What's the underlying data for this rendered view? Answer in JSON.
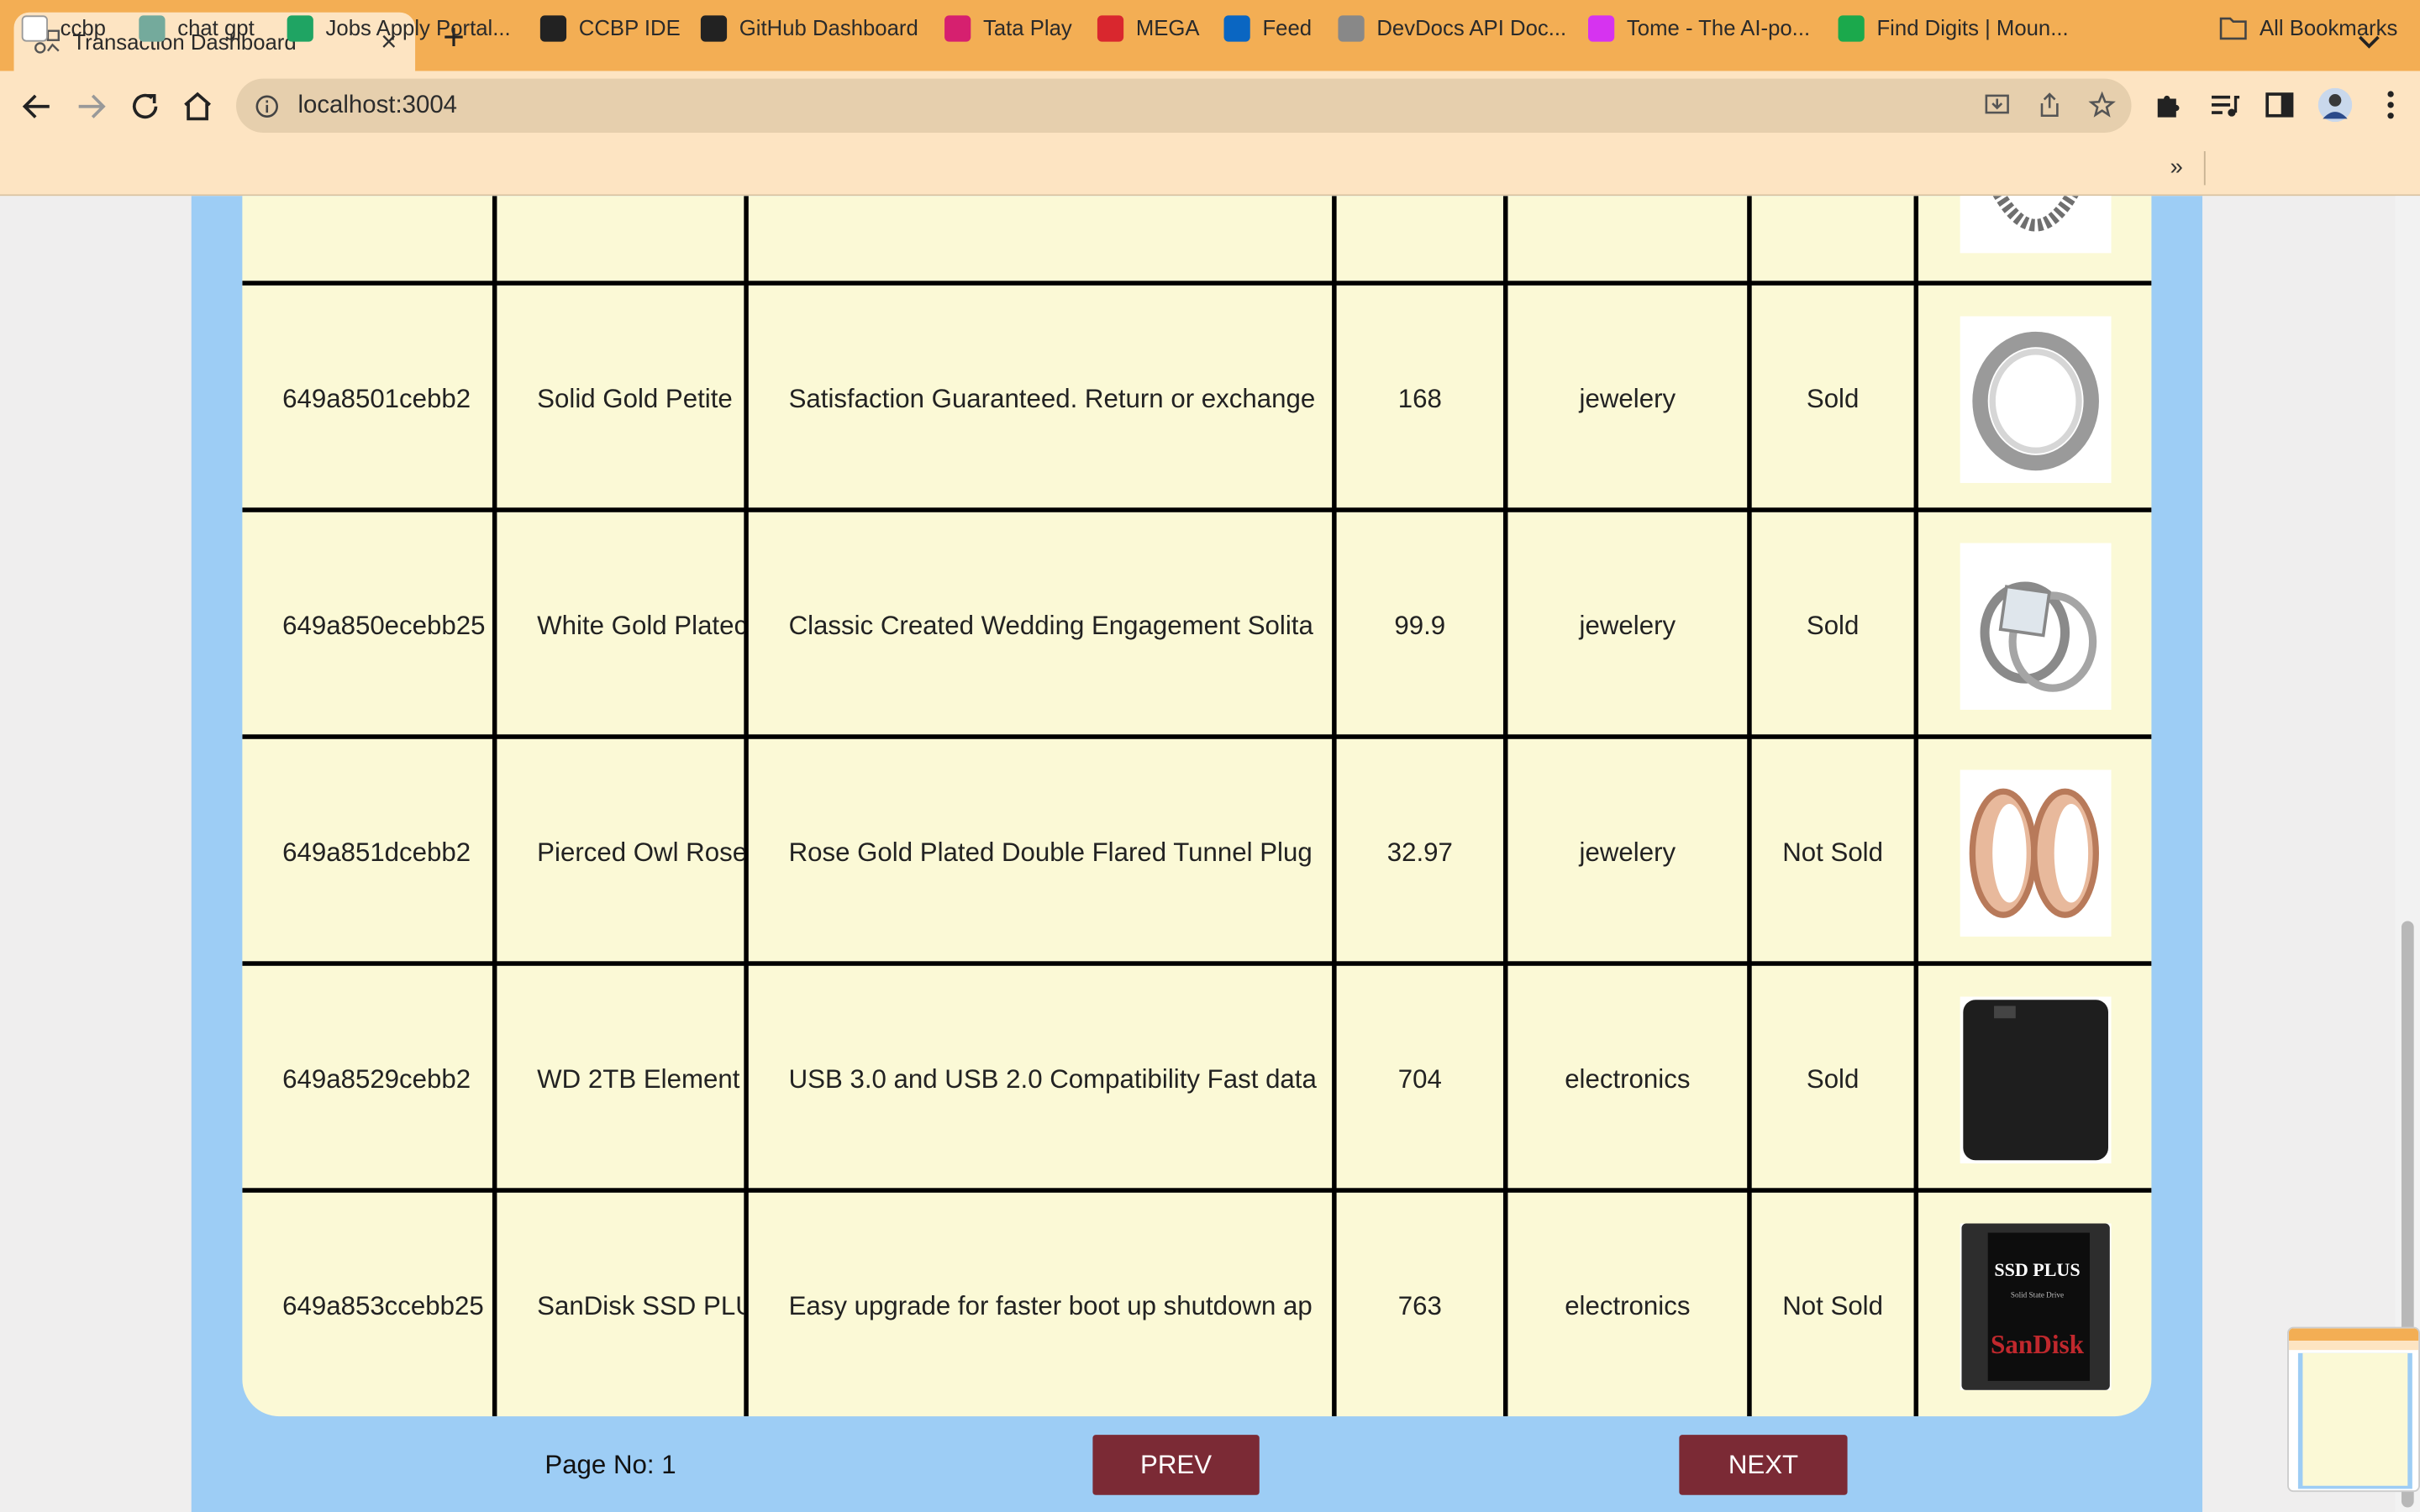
{
  "browser": {
    "tab_title": "Transaction Dashboard",
    "url": "localhost:3004",
    "bookmarks": [
      {
        "label": "ccbp",
        "icon": "ccbp-icon",
        "color": "#ffffff"
      },
      {
        "label": "chat gpt",
        "icon": "chatgpt-icon",
        "color": "#74aa9c"
      },
      {
        "label": "Jobs Apply Portal...",
        "icon": "plus-sheet-icon",
        "color": "#1fa463"
      },
      {
        "label": "CCBP IDE",
        "icon": "circle-arrow-icon",
        "color": "#222222"
      },
      {
        "label": "GitHub Dashboard",
        "icon": "github-icon",
        "color": "#222222"
      },
      {
        "label": "Tata Play",
        "icon": "tata-play-icon",
        "color": "#d6206f"
      },
      {
        "label": "MEGA",
        "icon": "mega-icon",
        "color": "#d9272e"
      },
      {
        "label": "Feed",
        "icon": "linkedin-icon",
        "color": "#0a66c2"
      },
      {
        "label": "DevDocs API Doc...",
        "icon": "devdocs-icon",
        "color": "#888888"
      },
      {
        "label": "Tome - The AI-po...",
        "icon": "tome-icon",
        "color": "#d633f0"
      },
      {
        "label": "Find Digits | Moun...",
        "icon": "hackerrank-icon",
        "color": "#1ba94c"
      }
    ],
    "more_label": "»",
    "all_bookmarks": "All Bookmarks"
  },
  "table": {
    "rows": [
      {
        "id": "649a8501cebb2",
        "title": "Solid Gold Petite",
        "description": "Satisfaction Guaranteed. Return or exchange",
        "price": "168",
        "category": "jewelery",
        "sold": "Sold",
        "image": "silver-ring-image"
      },
      {
        "id": "649a850ecebb25",
        "title": "White Gold Platec",
        "description": "Classic Created Wedding Engagement Solita",
        "price": "99.9",
        "category": "jewelery",
        "sold": "Sold",
        "image": "diamond-ring-image"
      },
      {
        "id": "649a851dcebb2",
        "title": "Pierced Owl Rose",
        "description": "Rose Gold Plated Double Flared Tunnel Plug",
        "price": "32.97",
        "category": "jewelery",
        "sold": "Not Sold",
        "image": "rose-gold-plug-image"
      },
      {
        "id": "649a8529cebb2",
        "title": "WD 2TB Element",
        "description": "USB 3.0 and USB 2.0 Compatibility Fast data",
        "price": "704",
        "category": "electronics",
        "sold": "Sold",
        "image": "hard-drive-image"
      },
      {
        "id": "649a853ccebb25",
        "title": "SanDisk SSD PLU",
        "description": "Easy upgrade for faster boot up shutdown ap",
        "price": "763",
        "category": "electronics",
        "sold": "Not Sold",
        "image": "ssd-image",
        "image_text": [
          "SSD PLUS",
          "Solid State Drive",
          "SanDisk"
        ]
      }
    ]
  },
  "pagination": {
    "page_label": "Page No: 1",
    "prev_label": "PREV",
    "next_label": "NEXT"
  },
  "colors": {
    "accent_button": "#7b2a35",
    "panel_bg": "#9dcdf5",
    "table_bg": "#fbf9d6",
    "tabbar": "#f3ae54"
  }
}
